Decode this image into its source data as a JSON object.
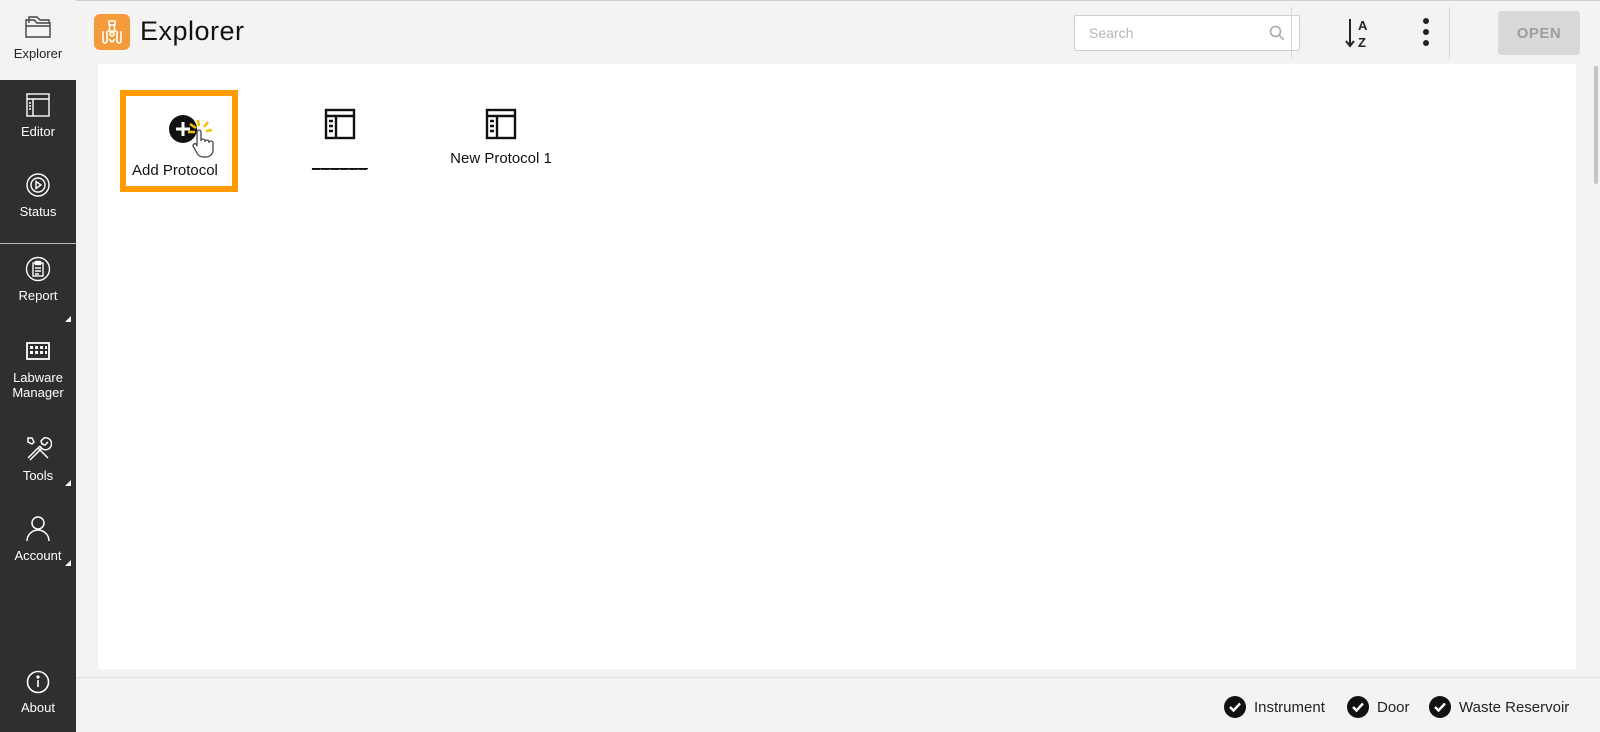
{
  "sidebar": {
    "items": [
      {
        "label": "Explorer",
        "icon": "folder-icon",
        "active": true
      },
      {
        "label": "Editor",
        "icon": "editor-icon"
      },
      {
        "label": "Status",
        "icon": "play-circle-icon"
      },
      {
        "label": "Report",
        "icon": "clipboard-icon",
        "submenu": true
      },
      {
        "label": "Labware Manager",
        "icon": "grid-plate-icon"
      },
      {
        "label": "Tools",
        "icon": "tools-icon",
        "submenu": true
      },
      {
        "label": "Account",
        "icon": "user-icon",
        "submenu": true
      },
      {
        "label": "About",
        "icon": "info-icon"
      }
    ]
  },
  "header": {
    "title": "Explorer",
    "logo_icon": "app-logo-icon",
    "search_placeholder": "Search",
    "search_value": "",
    "sort_icon": "sort-az-icon",
    "more_icon": "more-vertical-icon",
    "open_label": "OPEN"
  },
  "tiles": [
    {
      "label": "Add Protocol",
      "icon": "add-circle-icon",
      "highlighted": true
    },
    {
      "label": "______",
      "icon": "protocol-icon"
    },
    {
      "label": "New Protocol 1",
      "icon": "protocol-icon"
    }
  ],
  "footer": {
    "statuses": [
      {
        "label": "Instrument",
        "icon": "check-circle-icon"
      },
      {
        "label": "Door",
        "icon": "check-circle-icon"
      },
      {
        "label": "Waste Reservoir",
        "icon": "check-circle-icon"
      }
    ]
  },
  "colors": {
    "sidebar_bg": "#2f2f2f",
    "accent": "#f49a3a",
    "highlight": "#ff9a00",
    "open_disabled_bg": "#d9d9d9"
  }
}
